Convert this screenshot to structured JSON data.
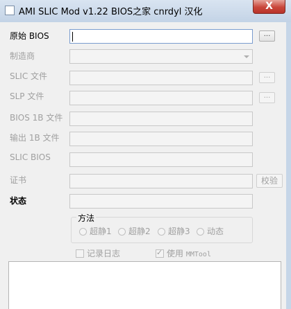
{
  "window": {
    "title": "AMI SLIC Mod v1.22  BIOS之家 cnrdyl 汉化",
    "close_label": "X"
  },
  "fields": {
    "original_bios_label": "原始 BIOS",
    "manufacturer_label": "制造商",
    "slic_file_label": "SLIC 文件",
    "slp_file_label": "SLP 文件",
    "bios_1b_file_label": "BIOS 1B 文件",
    "output_1b_file_label": "输出 1B 文件",
    "slic_bios_label": "SLIC BIOS",
    "certificate_label": "证书",
    "status_label": "状态"
  },
  "buttons": {
    "browse_label": "...",
    "verify_label": "校验"
  },
  "method": {
    "title": "方法",
    "options": [
      "超静1",
      "超静2",
      "超静3",
      "动态"
    ]
  },
  "options": {
    "log_label": "记录日志",
    "use_label": "使用",
    "mmtool_label": "MMTool"
  }
}
